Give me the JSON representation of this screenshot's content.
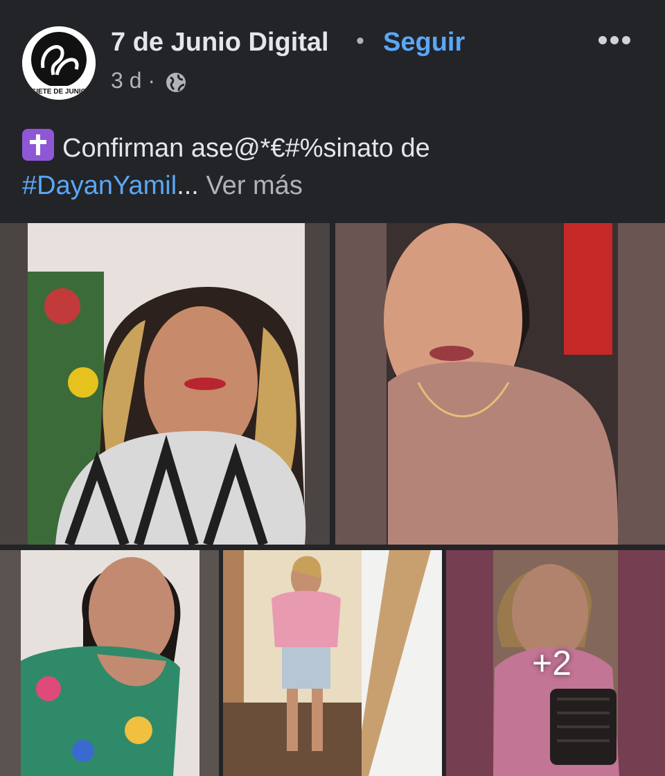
{
  "post": {
    "page_name": "7 de Junio Digital",
    "separator": "•",
    "follow_label": "Seguir",
    "time": "3 d ·",
    "avatar_text": "SIETE DE JUNIO",
    "text_main": "Confirman ase@*€#%sinato de",
    "hashtag": "#DayanYamil",
    "ellipsis": "...",
    "see_more": "Ver más",
    "more_photos": "+2"
  },
  "icons": {
    "privacy": "globe-icon",
    "options": "more-options-icon",
    "emoji": "latin-cross-emoji"
  },
  "colors": {
    "background": "#232427",
    "accent": "#5aa7f8",
    "secondary_text": "#b0b3b8"
  }
}
